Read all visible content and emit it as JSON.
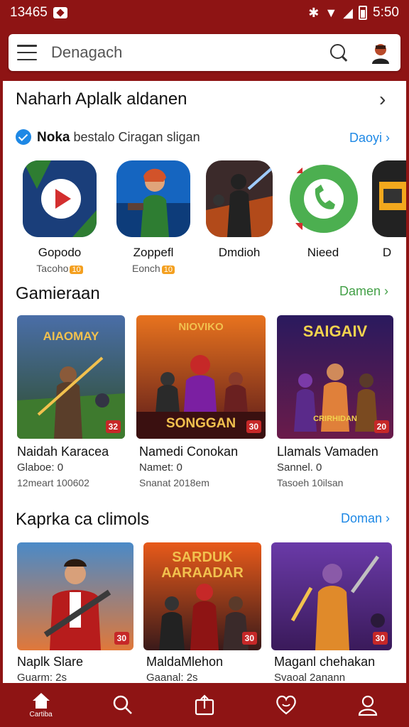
{
  "status_bar": {
    "time_left": "13465",
    "time_right": "5:50"
  },
  "search": {
    "placeholder": "Denagach"
  },
  "section_apps": {
    "title": "Naharh Aplalk aldanen",
    "verified_bold": "Noka",
    "verified_text": "bestalo Ciragan sligan",
    "link": "Daoyi",
    "apps": [
      {
        "name": "Gopodo",
        "sub": "Tacoho",
        "badge": "10"
      },
      {
        "name": "Zoppefl",
        "sub": "Eonch",
        "badge": "10"
      },
      {
        "name": "Dmdioh",
        "sub": ""
      },
      {
        "name": "Nieed",
        "sub": ""
      },
      {
        "name": "D",
        "sub": ""
      }
    ]
  },
  "section_games": {
    "title": "Gamieraan",
    "link": "Damen",
    "cards": [
      {
        "title": "Naidah Karacea",
        "line1": "Glaboe: 0",
        "line2": "12meart 100602",
        "rating": "32",
        "art_text": "AIAOMAY"
      },
      {
        "title": "Namedi Conokan",
        "line1": "Namet: 0",
        "line2": "Snanat 2018em",
        "rating": "30",
        "art_text": "SONGGAN",
        "art_top": "NIOVIKO"
      },
      {
        "title": "Llamals Vamaden",
        "line1": "Sannel. 0",
        "line2": "Tasoeh 10ilsan",
        "rating": "20",
        "art_text": "SAIGAIV",
        "art_sub": "CRIRHIDAN"
      }
    ]
  },
  "section_kaprka": {
    "title": "Kaprka ca  climols",
    "link": "Doman",
    "cards": [
      {
        "title": "Naplk Slare",
        "line1": "Guarm: 2s",
        "rating": "30"
      },
      {
        "title": "MaldaMlehon",
        "line1": "Gaanal: 2s",
        "rating": "30",
        "art_text": "SARDUK AARAADAR"
      },
      {
        "title": "Maganl chehakan",
        "line1": "Svaoal 2anann",
        "rating": "30"
      }
    ]
  },
  "bottom_nav": {
    "home_label": "Cartiba"
  },
  "colors": {
    "brand": "#8e1414",
    "green_link": "#43a047",
    "blue_link": "#1e88e5"
  }
}
